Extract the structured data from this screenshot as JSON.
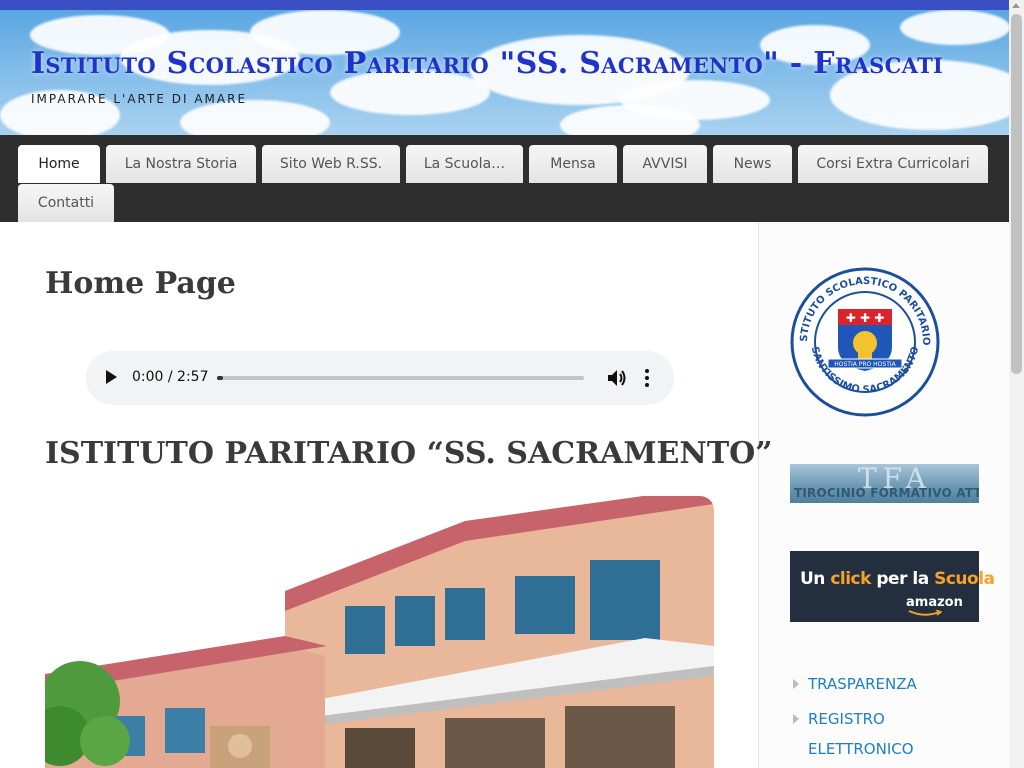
{
  "site": {
    "title": "Istituto Scolastico Paritario \"SS. Sacramento\" - Frascati",
    "tagline": "IMPARARE L'ARTE DI AMARE"
  },
  "nav": {
    "items": [
      {
        "label": "Home",
        "active": true
      },
      {
        "label": "La Nostra Storia"
      },
      {
        "label": "Sito Web R.SS."
      },
      {
        "label": "La Scuola…"
      },
      {
        "label": "Mensa"
      },
      {
        "label": "AVVISI"
      },
      {
        "label": "News"
      },
      {
        "label": "Corsi Extra Curricolari"
      },
      {
        "label": "Contatti"
      }
    ]
  },
  "main": {
    "page_title": "Home Page",
    "audio": {
      "time": "0:00 / 2:57",
      "progress": 0
    },
    "section_heading": "ISTITUTO PARITARIO “SS. SACRAMENTO”"
  },
  "sidebar": {
    "seal_text_top": "ISTITUTO SCOLASTICO PARITARIO",
    "seal_text_bottom": "SANTISSIMO SACRAMENTO",
    "seal_motto": "HOSTIA PRO HOSTIA",
    "tfa_letters": "TFA",
    "tfa_caption": "TIROCINIO FORMATIVO ATTIVO",
    "amazon_line1_a": "Un ",
    "amazon_line1_b": "click",
    "amazon_line1_c": " per la ",
    "amazon_line1_d": "Scuola",
    "amazon_line2": "amazon",
    "links": [
      "TRASPARENZA",
      "REGISTRO",
      "ELETTRONICO"
    ]
  },
  "colors": {
    "title_blue": "#1f33c9",
    "nav_bg": "#2e2e2e",
    "link_blue": "#1d80c3",
    "amazon_orange": "#f7a12b"
  }
}
